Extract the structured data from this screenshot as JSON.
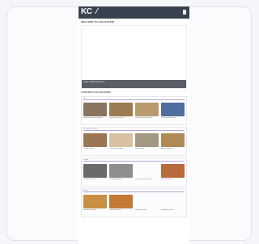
{
  "header": {
    "logo": "KC",
    "menu_icon": "hamburger-icon"
  },
  "welcome_title": "Welcome to Collection",
  "hero": {
    "caption": "Kate Yoda featured"
  },
  "collections_title": "Curated Collections",
  "collections": [
    {
      "name": "Art",
      "items": [
        {
          "caption": "Studio portrait of a woman",
          "color": "#8a7660"
        },
        {
          "caption": "Group of men, 1890s",
          "color": "#9a7b52"
        },
        {
          "caption": "Painting with landscape",
          "color": "#b99a6f"
        },
        {
          "caption": "Sea view with ships",
          "color": "#4e6f9e"
        }
      ]
    },
    {
      "name": "Sculpture & Objects",
      "items": [
        {
          "caption": "Ceramic vessel",
          "color": "#9c7552"
        },
        {
          "caption": "Carved horse figure",
          "color": "#d7c1a0"
        },
        {
          "caption": "Figure statue",
          "color": "#a59883"
        },
        {
          "caption": "Bronze figurine",
          "color": "#b08a55"
        }
      ]
    },
    {
      "name": "People",
      "items": [
        {
          "caption": "Portrait of a man",
          "color": "#6b6b6b"
        },
        {
          "caption": "Family photograph",
          "color": "#8e8e8e"
        },
        {
          "caption": "Letter from the archive",
          "color": ""
        },
        {
          "caption": "Artist self portrait",
          "color": "#b76a3c"
        }
      ]
    },
    {
      "name": "Nature",
      "items": [
        {
          "caption": "Botanical painting",
          "color": "#c98f45"
        },
        {
          "caption": "Flowers and fruit",
          "color": "#c47a35"
        },
        {
          "caption": "Specimen notes",
          "color": ""
        },
        {
          "caption": "Herbarium record",
          "color": ""
        }
      ]
    }
  ]
}
